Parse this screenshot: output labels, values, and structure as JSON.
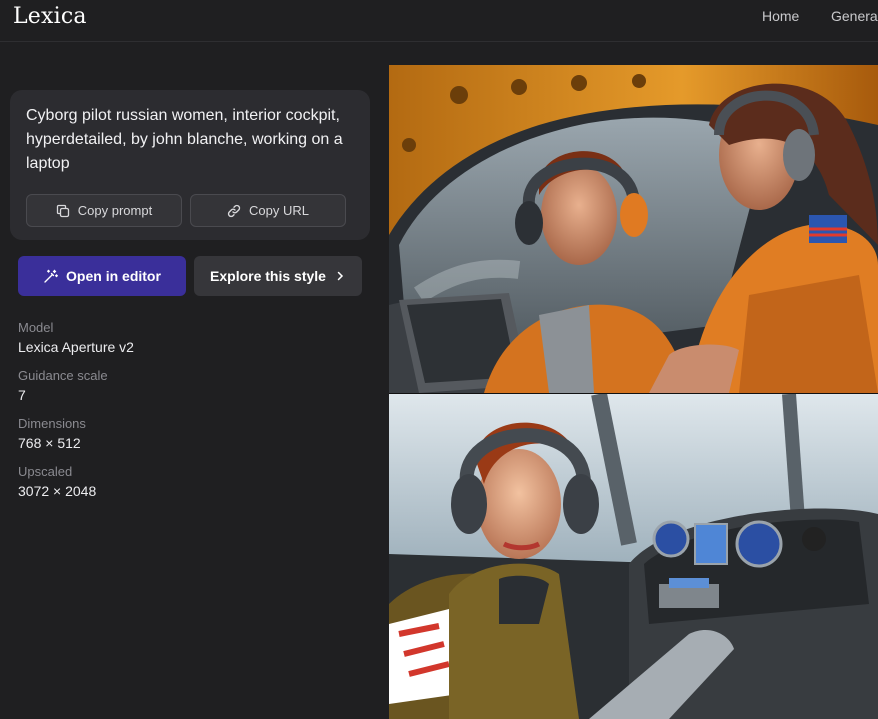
{
  "header": {
    "logo": "Lexica",
    "nav": {
      "home": "Home",
      "generate": "Genera"
    }
  },
  "prompt": {
    "text": "Cyborg pilot russian women, interior cockpit, hyperdetailed, by john blanche, working on a laptop",
    "copy_prompt_label": "Copy prompt",
    "copy_url_label": "Copy URL"
  },
  "actions": {
    "open_editor_label": "Open in editor",
    "explore_label": "Explore this style"
  },
  "meta": {
    "model": {
      "label": "Model",
      "value": "Lexica Aperture v2"
    },
    "guidance": {
      "label": "Guidance scale",
      "value": "7"
    },
    "dimensions": {
      "label": "Dimensions",
      "value": "768 × 512"
    },
    "upscaled": {
      "label": "Upscaled",
      "value": "3072 × 2048"
    }
  },
  "colors": {
    "background": "#1f1f21",
    "card": "#2c2c30",
    "primary_button": "#3a2f9a",
    "secondary_button": "#36363a"
  },
  "icons": {
    "copy": "copy-icon",
    "link": "link-icon",
    "wand": "magic-wand-icon",
    "chevron": "chevron-right-icon"
  }
}
